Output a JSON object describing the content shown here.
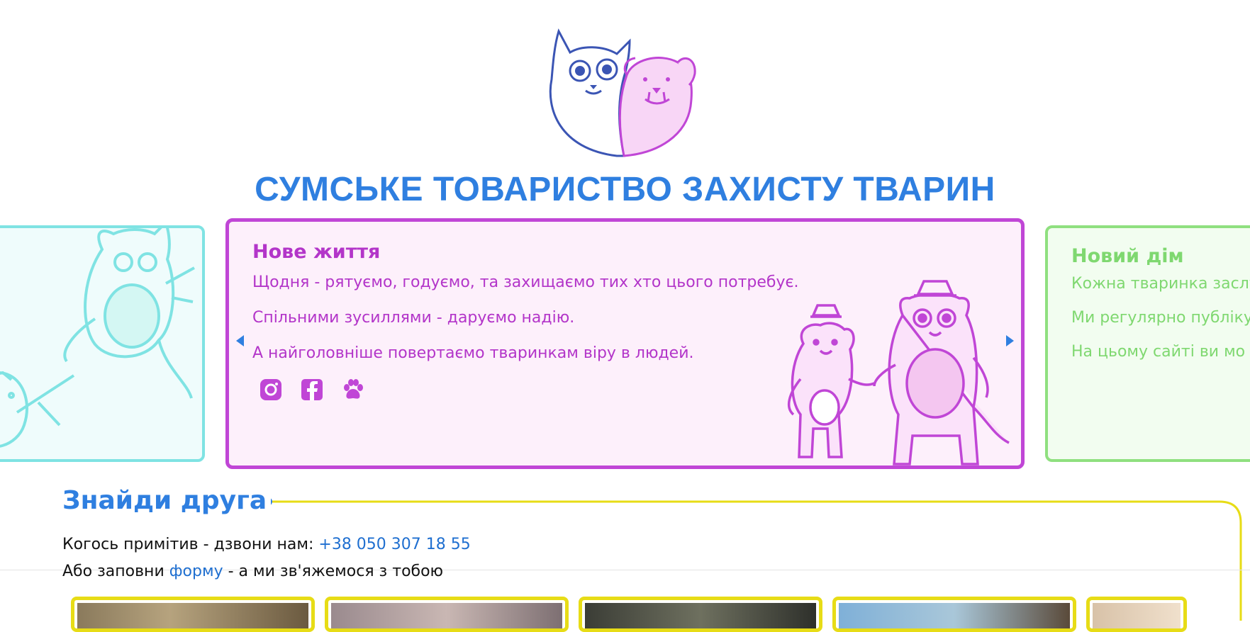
{
  "header": {
    "title": "СУМСЬКЕ ТОВАРИСТВО ЗАХИСТУ ТВАРИН"
  },
  "colors": {
    "brand_blue": "#2f7fe0",
    "main_card": "#c046d6",
    "left_card": "#7fe3e3",
    "right_card": "#8fe07f",
    "tile_border": "#e7dc16"
  },
  "slider": {
    "main": {
      "title": "Нове життя",
      "lines": [
        "Щодня - рятуємо, годуємо, та захищаємо тих хто цього потребує.",
        "Спільними зусиллями - даруємо надію.",
        "А найголовніше повертаємо тваринкам віру в людей."
      ],
      "icons": [
        "instagram-icon",
        "facebook-icon",
        "paw-icon"
      ]
    },
    "right": {
      "title": "Новий дім",
      "lines": [
        "Кожна тваринка заслу",
        "Ми регулярно публіку",
        "На цьому сайті ви мо"
      ]
    }
  },
  "find_friend": {
    "heading": "Знайди друга",
    "line1_text": "Когось примітив - дзвони нам: ",
    "phone": "+38 050 307 18 55",
    "line2_prefix": "Або заповни ",
    "form_link": "форму",
    "line2_suffix": " - а ми зв'яжемося з тобою"
  }
}
